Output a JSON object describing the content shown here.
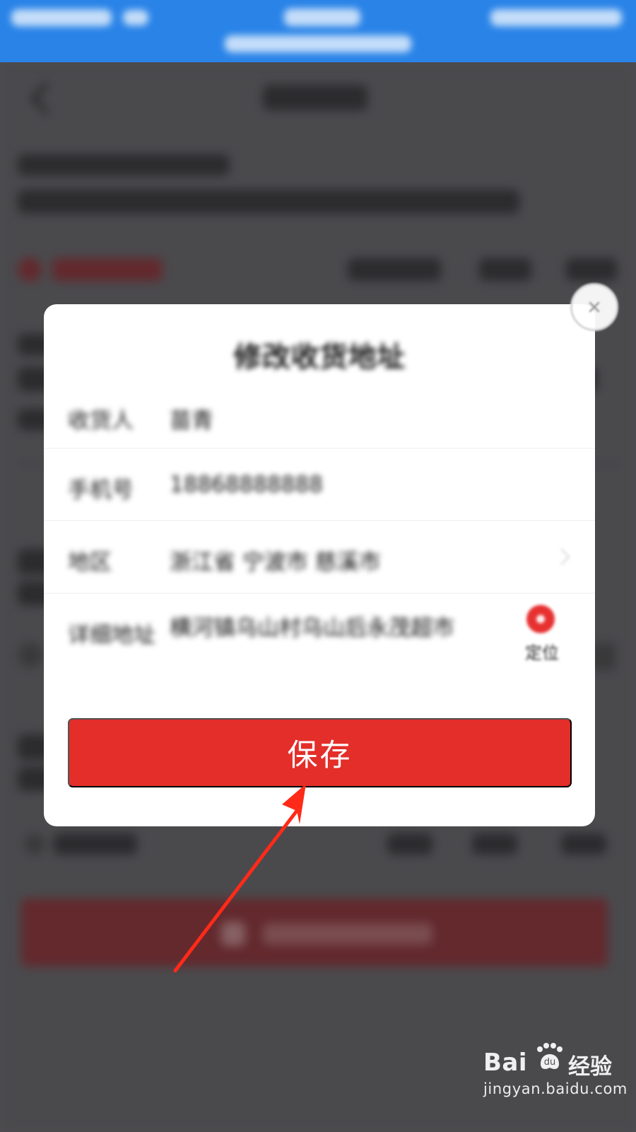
{
  "save_button": {
    "label": "保存"
  },
  "watermark": {
    "brand_text": "Bai",
    "brand_cn": "经验",
    "url": "jingyan.baidu.com"
  },
  "colors": {
    "status_bar": "#2a84e8",
    "save_button": "#e32e2a",
    "background": "#4f4e52",
    "arrow": "#ff2a18",
    "modal": "#ffffff"
  },
  "icons": {
    "close": "close-icon",
    "chevron": "chevron-right-icon",
    "locate": "location-pin-icon",
    "watermark_logo": "baidu-paw-logo"
  }
}
